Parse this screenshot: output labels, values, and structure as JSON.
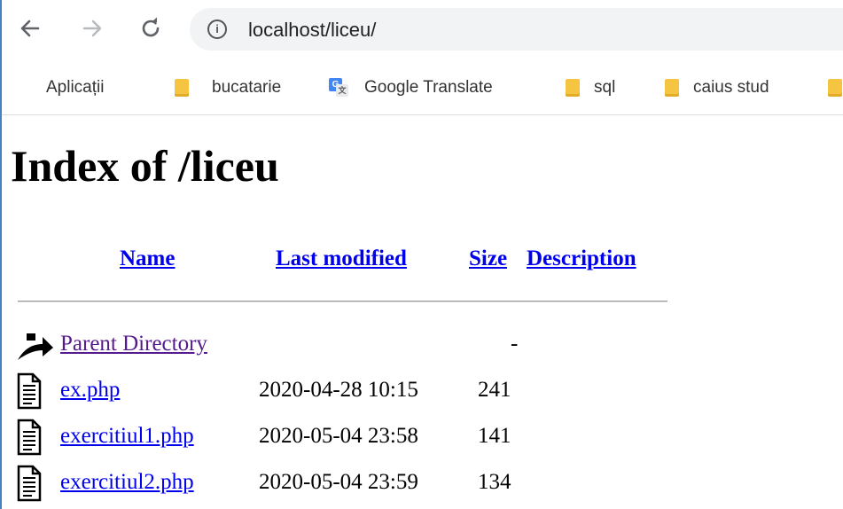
{
  "browser": {
    "url": "localhost/liceu/"
  },
  "bookmarks": [
    {
      "label": "Aplicații",
      "icon": "apps-grid-icon"
    },
    {
      "label": "bucatarie",
      "icon": "folder-icon"
    },
    {
      "label": "Google Translate",
      "icon": "google-translate-icon"
    },
    {
      "label": "sql",
      "icon": "folder-icon"
    },
    {
      "label": "caius stud",
      "icon": "folder-icon"
    }
  ],
  "page": {
    "title": "Index of /liceu",
    "columns": {
      "name": "Name",
      "last_modified": "Last modified",
      "size": "Size",
      "description": "Description"
    },
    "rows": [
      {
        "name": "Parent Directory",
        "modified": "",
        "size": "-",
        "icon": "back-arrow-icon"
      },
      {
        "name": "ex.php",
        "modified": "2020-04-28 10:15",
        "size": "241",
        "icon": "text-file-icon"
      },
      {
        "name": "exercitiul1.php",
        "modified": "2020-05-04 23:58",
        "size": "141",
        "icon": "text-file-icon"
      },
      {
        "name": "exercitiul2.php",
        "modified": "2020-05-04 23:59",
        "size": "134",
        "icon": "text-file-icon"
      }
    ]
  },
  "colors": {
    "link": "#0000ee",
    "visited_link": "#551a8b",
    "omnibox_bg": "#f1f3f4",
    "folder": "#f5c542"
  }
}
